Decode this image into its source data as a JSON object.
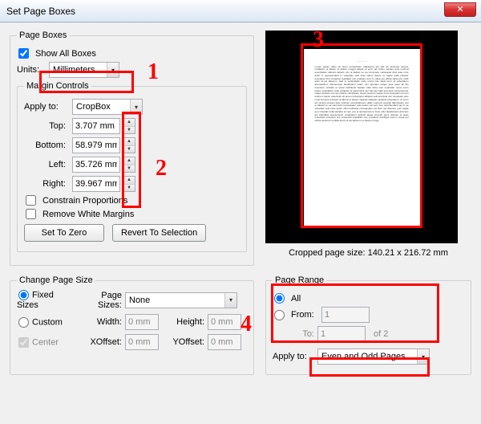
{
  "title": "Set Page Boxes",
  "pageboxes": {
    "legend": "Page Boxes",
    "show_all": "Show All Boxes",
    "units_label": "Units:",
    "units_value": "Millimeters",
    "margin_controls": "Margin Controls",
    "apply_to_label": "Apply to:",
    "apply_to_value": "CropBox",
    "top_label": "Top:",
    "top_value": "3.707 mm",
    "bottom_label": "Bottom:",
    "bottom_value": "58.979 mm",
    "left_label": "Left:",
    "left_value": "35.726 mm",
    "right_label": "Right:",
    "right_value": "39.967 mm",
    "constrain": "Constrain Proportions",
    "remove_white": "Remove White Margins",
    "set_zero": "Set To Zero",
    "revert": "Revert To Selection"
  },
  "preview": {
    "caption": "Cropped page size: 140.21 x 216.72 mm"
  },
  "changepage": {
    "legend": "Change Page Size",
    "fixed": "Fixed Sizes",
    "custom": "Custom",
    "center": "Center",
    "pagesizes_label": "Page Sizes:",
    "pagesizes_value": "None",
    "width_label": "Width:",
    "width_value": "0 mm",
    "height_label": "Height:",
    "height_value": "0 mm",
    "xoff_label": "XOffset:",
    "xoff_value": "0 mm",
    "yoff_label": "YOffset:",
    "yoff_value": "0 mm"
  },
  "pagerange": {
    "legend": "Page Range",
    "all": "All",
    "from": "From:",
    "from_value": "1",
    "to": "To:",
    "to_value": "1",
    "of": "of 2",
    "apply_to_label": "Apply to:",
    "apply_to_value": "Even and Odd Pages"
  },
  "annotate": {
    "n1": "1",
    "n2": "2",
    "n3": "3",
    "n4": "4"
  }
}
